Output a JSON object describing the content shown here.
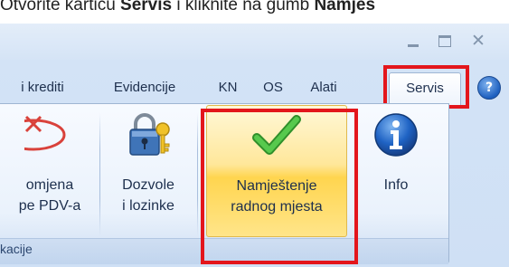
{
  "instruction": {
    "prefix": "Otvorite karticu ",
    "tab_bold": "Servis",
    "middle": " i kliknite na gumb ",
    "button_bold": "Namješ"
  },
  "window_controls": {
    "minimize_icon": "minimize-icon",
    "maximize_icon": "maximize-icon",
    "close_icon": "close-icon"
  },
  "tabs": [
    {
      "label": "i krediti"
    },
    {
      "label": "Evidencije"
    },
    {
      "label": "KN"
    },
    {
      "label": "OS"
    },
    {
      "label": "Alati"
    },
    {
      "label": "Servis"
    }
  ],
  "active_tab": "Servis",
  "help_icon": {
    "icon": "help-icon",
    "glyph": "?"
  },
  "ribbon": {
    "buttons": [
      {
        "line1": "omjena",
        "line2": "pe PDV-a",
        "icon": "change-vat-icon"
      },
      {
        "line1": "Dozvole",
        "line2": "i lozinke",
        "icon": "padlock-key-icon"
      },
      {
        "line1": "Namještenje",
        "line2": "radnog mjesta",
        "icon": "checkmark-icon"
      },
      {
        "line1": "Info",
        "line2": "",
        "icon": "info-icon"
      }
    ],
    "group_label": "kacije"
  },
  "colors": {
    "highlight_frame": "#e3161c",
    "hover_fill": "#ffd54f",
    "ribbon_bg": "#eaf2fc",
    "checkmark": "#3fb23a",
    "info_blue": "#1d5fbf"
  }
}
